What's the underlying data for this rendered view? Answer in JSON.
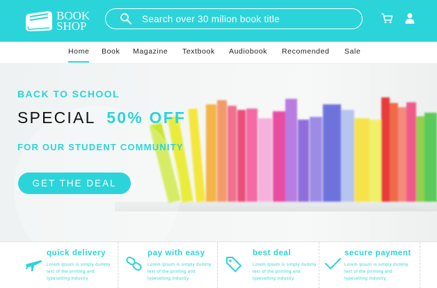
{
  "brand": {
    "line1": "BOOK",
    "line2": "SHOP",
    "logo_icon": "book-icon"
  },
  "search": {
    "placeholder": "Search over 30 milion book title",
    "icon": "search-icon"
  },
  "header_icons": [
    "cart-icon",
    "user-icon"
  ],
  "nav": {
    "items": [
      {
        "label": "Home",
        "active": true
      },
      {
        "label": "Book"
      },
      {
        "label": "Magazine"
      },
      {
        "label": "Textbook"
      },
      {
        "label": "Audiobook"
      },
      {
        "label": "Recomended"
      },
      {
        "label": "Sale"
      }
    ]
  },
  "hero": {
    "line1": "BACK TO SCHOOL",
    "line2_prefix": "SPECIAL",
    "line2_highlight": "50% OFF",
    "line3": "FOR OUR STUDENT COMMUNITY",
    "cta_label": "GET THE DEAL"
  },
  "features": [
    {
      "title": "quick delivery",
      "text": "Lorem Ipsum is simply dummy text of the printing and typesetting industry",
      "icon": "airplane-icon"
    },
    {
      "title": "pay with easy",
      "text": "Lorem Ipsum is simply dummy text of the printing and typesetting industry",
      "icon": "chain-link-icon"
    },
    {
      "title": "best deal",
      "text": "Lorem Ipsum is simply dummy text of the printing and typesetting industry.",
      "icon": "price-tag-icon"
    },
    {
      "title": "secure payment",
      "text": "Lorem Ipsum is simply dummy text of the printing and typesetting industry.",
      "icon": "checkmark-icon"
    }
  ],
  "colors": {
    "accent": "#2bd4d9",
    "text": "#222222",
    "white": "#ffffff"
  }
}
